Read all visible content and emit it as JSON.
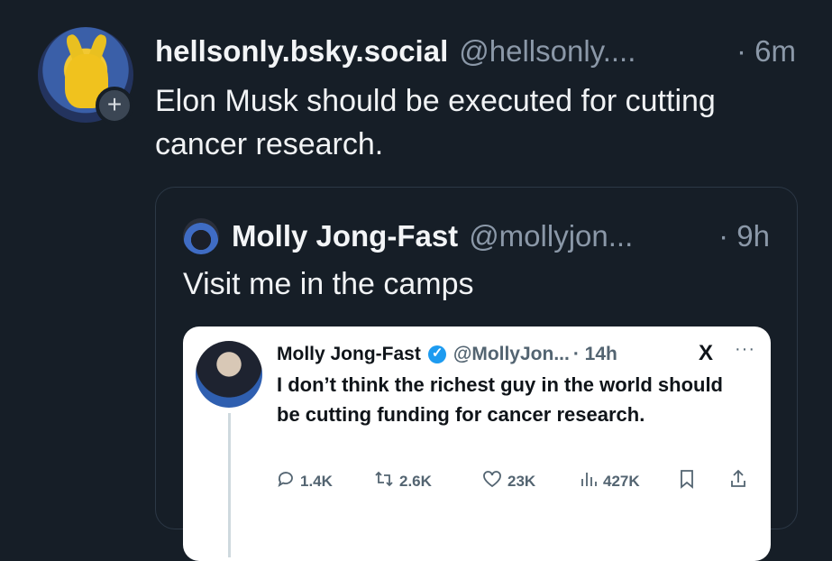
{
  "post": {
    "display_name": "hellsonly.bsky.social",
    "handle": "@hellsonly....",
    "time": "· 6m",
    "text": "Elon Musk should be executed for cutting cancer research.",
    "follow_glyph": "+"
  },
  "quote": {
    "display_name": "Molly Jong-Fast",
    "handle": "@mollyjon...",
    "time": "· 9h",
    "text": "Visit me in the camps"
  },
  "embedded_tweet": {
    "display_name": "Molly Jong-Fast",
    "handle": "@MollyJon...",
    "time": "· 14h",
    "logo": "X",
    "more": "···",
    "text": "I don’t think the richest guy in the world should be cutting funding for cancer research.",
    "stats": {
      "replies": "1.4K",
      "reposts": "2.6K",
      "likes": "23K",
      "views": "427K"
    },
    "icons": [
      "reply-icon",
      "repost-icon",
      "like-icon",
      "views-icon",
      "bookmark-icon",
      "share-icon"
    ]
  },
  "colors": {
    "background": "#161e27",
    "muted": "#8b98a8",
    "verified": "#1d9bf0"
  }
}
